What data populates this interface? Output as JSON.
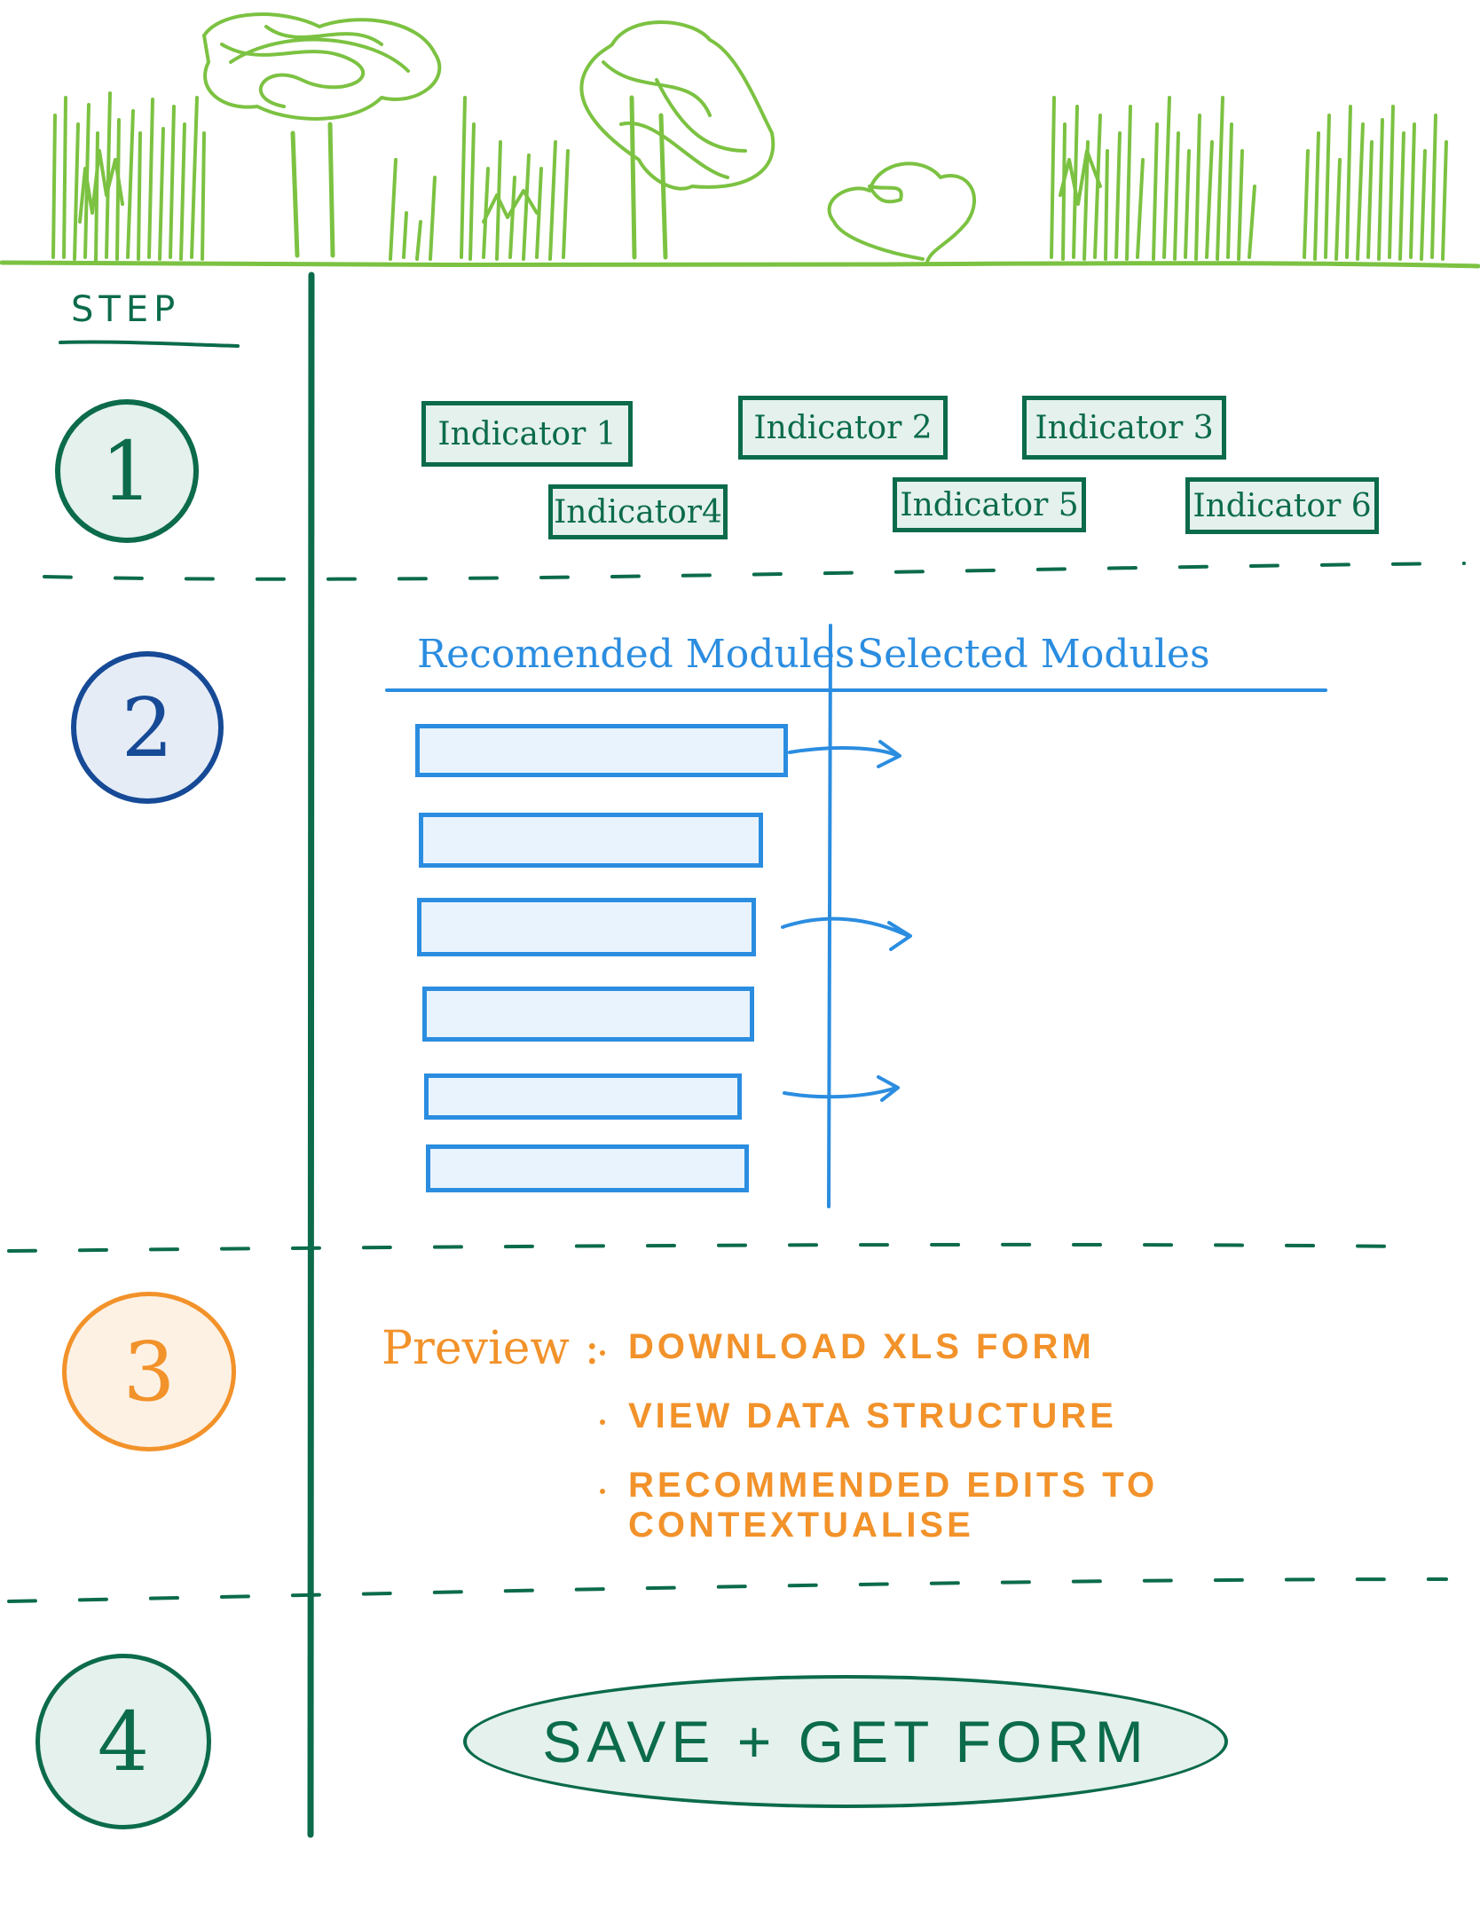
{
  "colors": {
    "forest": "#7cc242",
    "primary_green": "#0b6b4a",
    "light_green": "#e4f1ec",
    "blue": "#2b8de0",
    "dark_blue": "#164a96",
    "light_blue": "#e8f3fd",
    "orange": "#f2922a",
    "light_orange": "#fdf1e4"
  },
  "header": {
    "step_label": "STEP"
  },
  "steps": [
    {
      "number": "1"
    },
    {
      "number": "2"
    },
    {
      "number": "3"
    },
    {
      "number": "4"
    }
  ],
  "step1": {
    "indicators": [
      "Indicator 1",
      "Indicator 2",
      "Indicator 3",
      "Indicator4",
      "Indicator 5",
      "Indicator 6"
    ]
  },
  "step2": {
    "recommended_header": "Recomended Modules",
    "selected_header": "Selected Modules",
    "modules_count_visible": 6
  },
  "step3": {
    "label": "Preview :",
    "items": [
      "DOWNLOAD XLS FORM",
      "VIEW DATA STRUCTURE",
      "RECOMMENDED EDITS TO CONTEXTUALISE"
    ]
  },
  "step4": {
    "button_label": "SAVE + GET FORM"
  }
}
